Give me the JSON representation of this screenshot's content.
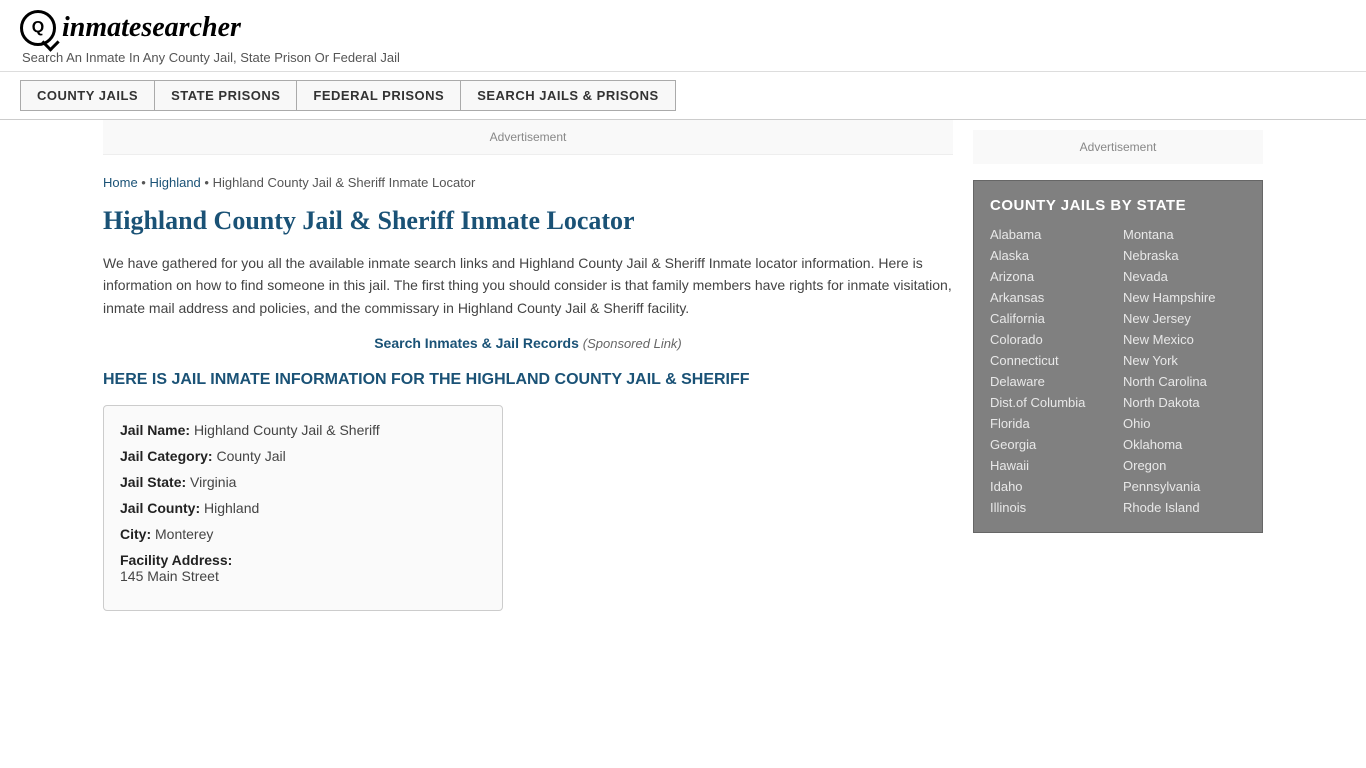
{
  "header": {
    "logo_symbol": "Q",
    "logo_text_part1": "inmate",
    "logo_text_part2": "searcher",
    "tagline": "Search An Inmate In Any County Jail, State Prison Or Federal Jail"
  },
  "nav": {
    "items": [
      {
        "label": "COUNTY JAILS",
        "href": "#"
      },
      {
        "label": "STATE PRISONS",
        "href": "#"
      },
      {
        "label": "FEDERAL PRISONS",
        "href": "#"
      },
      {
        "label": "SEARCH JAILS & PRISONS",
        "href": "#"
      }
    ]
  },
  "ad_banner": "Advertisement",
  "breadcrumb": {
    "home_label": "Home",
    "separator1": " • ",
    "highland_label": "Highland",
    "separator2": " • ",
    "current": "Highland County Jail & Sheriff Inmate Locator"
  },
  "page_title": "Highland County Jail & Sheriff Inmate Locator",
  "description": "We have gathered for you all the available inmate search links and Highland County Jail & Sheriff Inmate locator information. Here is information on how to find someone in this jail. The first thing you should consider is that family members have rights for inmate visitation, inmate mail address and policies, and the commissary in Highland County Jail & Sheriff facility.",
  "sponsored": {
    "link_text": "Search Inmates & Jail Records",
    "note": "(Sponsored Link)"
  },
  "section_header": "HERE IS JAIL INMATE INFORMATION FOR THE HIGHLAND COUNTY JAIL & SHERIFF",
  "info_box": {
    "jail_name_label": "Jail Name:",
    "jail_name": "Highland County Jail & Sheriff",
    "jail_category_label": "Jail Category:",
    "jail_category": "County Jail",
    "jail_state_label": "Jail State:",
    "jail_state": "Virginia",
    "jail_county_label": "Jail County:",
    "jail_county": "Highland",
    "city_label": "City:",
    "city": "Monterey",
    "address_label": "Facility Address:",
    "address": "145 Main Street"
  },
  "sidebar_ad": "Advertisement",
  "state_list": {
    "title": "COUNTY JAILS BY STATE",
    "col1": [
      "Alabama",
      "Alaska",
      "Arizona",
      "Arkansas",
      "California",
      "Colorado",
      "Connecticut",
      "Delaware",
      "Dist.of Columbia",
      "Florida",
      "Georgia",
      "Hawaii",
      "Idaho",
      "Illinois"
    ],
    "col2": [
      "Montana",
      "Nebraska",
      "Nevada",
      "New Hampshire",
      "New Jersey",
      "New Mexico",
      "New York",
      "North Carolina",
      "North Dakota",
      "Ohio",
      "Oklahoma",
      "Oregon",
      "Pennsylvania",
      "Rhode Island"
    ]
  }
}
